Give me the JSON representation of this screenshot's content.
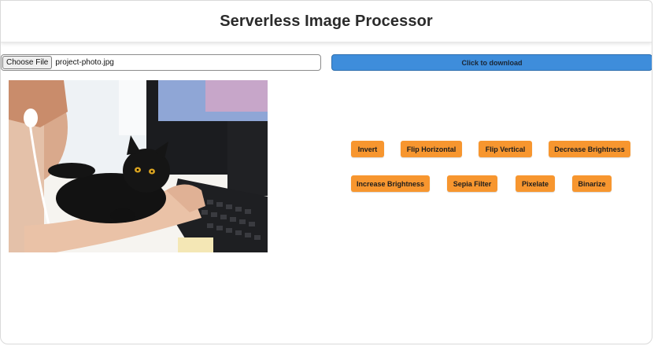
{
  "header": {
    "title": "Serverless Image Processor"
  },
  "file_input": {
    "button_label": "Choose File",
    "file_name": "project-photo.jpg"
  },
  "download": {
    "label": "Click to download"
  },
  "image": {
    "description_icon": "photo-icon"
  },
  "operations": {
    "invert": "Invert",
    "flip_horizontal": "Flip Horizontal",
    "flip_vertical": "Flip Vertical",
    "decrease_brightness": "Decrease Brightness",
    "increase_brightness": "Increase Brightness",
    "sepia_filter": "Sepia Filter",
    "pixelate": "Pixelate",
    "binarize": "Binarize"
  },
  "colors": {
    "accent_blue": "#3e8ddb",
    "button_orange": "#f7962f"
  }
}
